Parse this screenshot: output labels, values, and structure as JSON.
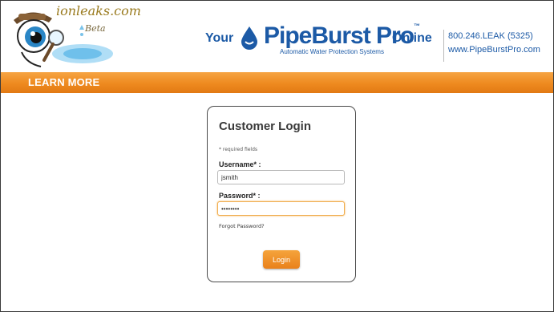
{
  "header": {
    "logo_text": "ionleaks.com",
    "logo_beta": "Beta",
    "brand_your": "Your",
    "brand_name": "PipeBurst Pro",
    "brand_tm": "™",
    "brand_tagline": "Automatic Water Protection Systems",
    "brand_online": "Online",
    "phone": "800.246.LEAK (5325)",
    "website": "www.PipeBurstPro.com"
  },
  "bar": {
    "label": "LEARN MORE"
  },
  "login": {
    "title": "Customer Login",
    "required_note": "* required fields",
    "username_label": "Username* :",
    "username_value": "jsmith",
    "password_label": "Password* :",
    "password_value": "••••••••",
    "forgot_link": "Forgot Password?",
    "login_button": "Login"
  },
  "colors": {
    "brand_blue": "#1c5aa6",
    "accent_orange": "#ee8a1f"
  }
}
